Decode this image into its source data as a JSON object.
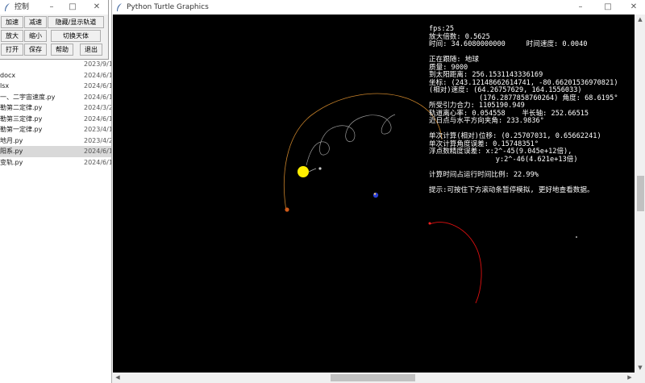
{
  "explorer": {
    "files": [
      {
        "name": "",
        "date": "2023/9/1"
      },
      {
        "name": "docx",
        "date": "2024/6/1"
      },
      {
        "name": "lsx",
        "date": "2024/6/1"
      },
      {
        "name": "一、二宇宙速度.py",
        "date": "2024/6/1"
      },
      {
        "name": "勒第二定律.py",
        "date": "2024/3/2"
      },
      {
        "name": "勒第三定律.py",
        "date": "2024/6/1"
      },
      {
        "name": "勒第一定律.py",
        "date": "2023/4/1"
      },
      {
        "name": "地月.py",
        "date": "2023/4/2"
      },
      {
        "name": "阳系.py",
        "date": "2024/6/1"
      },
      {
        "name": "变轨.py",
        "date": "2024/6/1"
      }
    ],
    "selected_index": 8
  },
  "control": {
    "title": "控制",
    "buttons": {
      "speed_up": "加速",
      "slow_down": "减速",
      "toggle_orbit": "隐藏/显示轨道",
      "zoom_in": "放大",
      "zoom_out": "缩小",
      "switch_body": "切换天体",
      "open": "打开",
      "save": "保存",
      "help": "帮助",
      "exit": "退出"
    },
    "window_buttons": {
      "minimize": "–",
      "maximize": "□",
      "close": "✕"
    }
  },
  "turtle_window": {
    "title": "Python Turtle Graphics",
    "window_buttons": {
      "minimize": "–",
      "maximize": "□",
      "close": "✕"
    }
  },
  "overlay": {
    "lines": [
      "fps:25",
      "放大倍数: 0.5625",
      "时间: 34.6080000000     时间速度: 0.0040",
      "",
      "正在跟随: 地球",
      "质量: 9000",
      "到太阳距离: 256.1531143336169",
      "坐标: (243.12148662614741, -80.66201536970821)",
      "(相对)速度: (64.26757629, 164.1556033)",
      "            (176.2877858760264) 角度: 68.6195°",
      "所受引力合力: 1105190.949",
      "轨道离心率: 0.054558    半长轴: 252.66515",
      "近日点与水平方向夹角: 233.9836°",
      "",
      "单次计算(相对)位移: (0.25707031, 0.65662241)",
      "单次计算角度误差: 0.15748351°",
      "浮点数精度误差: x:2^-45(9.045e+12倍),",
      "                y:2^-46(4.621e+13倍)",
      "",
      "计算时间占运行时间比例: 22.99%",
      "",
      "提示:可按住下方滚动条暂停模拟, 更好地查看数据。"
    ]
  },
  "colors": {
    "sun": "#ffee00",
    "orbit": "#c8822a",
    "trail": "#9a9a9a",
    "planet_blue": "#2a3fd0",
    "red_orbit": "#e01010"
  },
  "scroll": {
    "horizontal_position": 0.5,
    "vertical_position": 0.53
  }
}
